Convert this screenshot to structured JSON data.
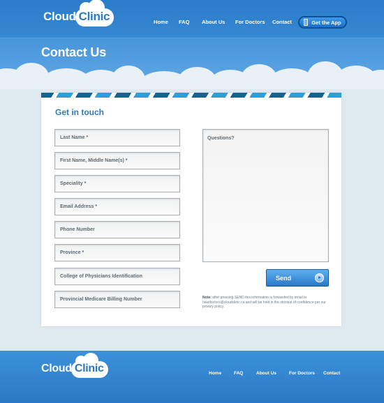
{
  "header": {
    "logo": {
      "cloud": "Cloud",
      "clinic": "Clinic"
    },
    "nav": [
      "Home",
      "FAQ",
      "About Us",
      "For Doctors",
      "Contact"
    ],
    "app_button": "Get the App"
  },
  "page_title": "Contact Us",
  "form": {
    "title": "Get in touch",
    "fields": [
      "Last Name *",
      "First Name, Middle Name(s) *",
      "Speciality *",
      "Email Address *",
      "Phone Number",
      "Province *",
      "College of Physicians Identification",
      "Provincial Medicare Billing Number"
    ],
    "questions_placeholder": "Questions?",
    "send_label": "Send",
    "note_label": "Note:",
    "note_text": "after pressing SEND this information is forwarded by email to newdoctors@cloudclinic.ca and will be held in the strictest of confidence per our privacy policy."
  },
  "footer": {
    "logo": {
      "cloud": "Cloud",
      "clinic": "Clinic"
    },
    "nav": [
      "Home",
      "FAQ",
      "About Us",
      "For Doctors",
      "Contact"
    ]
  },
  "colors": {
    "primary_blue": "#2c7fcc",
    "title_blue": "#2c7bbd",
    "bg": "#dfe9f0"
  }
}
